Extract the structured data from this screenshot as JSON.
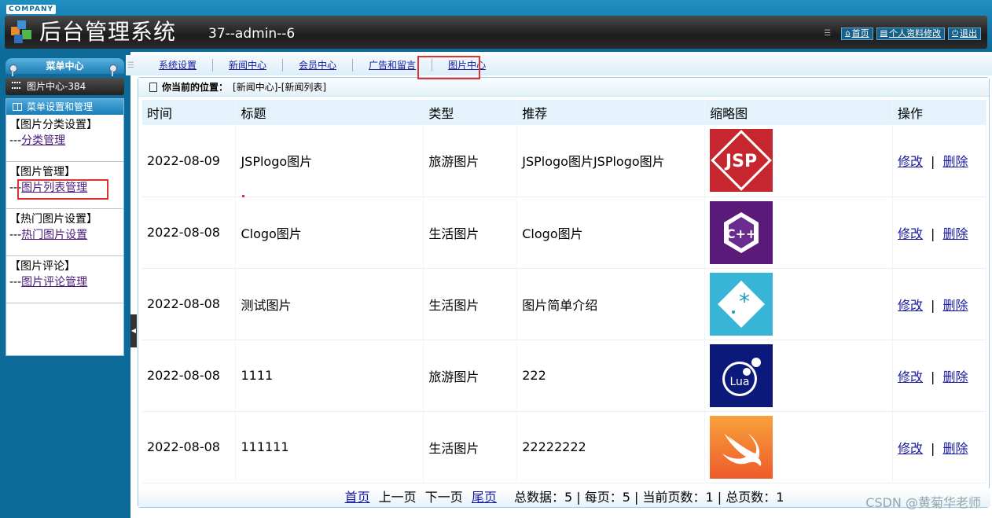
{
  "header": {
    "company": "COMPANY",
    "title": "后台管理系统",
    "user_info": "37--admin--6",
    "links": [
      {
        "label": "首页",
        "icon": "home-icon"
      },
      {
        "label": "个人资料修改",
        "icon": "document-icon"
      },
      {
        "label": "退出",
        "icon": "power-icon"
      }
    ]
  },
  "sidebar": {
    "title": "菜单中心",
    "current": "图片中心-384",
    "panel_title": "菜单设置和管理",
    "groups": [
      {
        "title": "【图片分类设置】",
        "prefix": "---",
        "link": "分类管理"
      },
      {
        "title": "【图片管理】",
        "prefix": "---",
        "link": "图片列表管理"
      },
      {
        "title": "【热门图片设置】",
        "prefix": "---",
        "link": "热门图片设置"
      },
      {
        "title": "【图片评论】",
        "prefix": "---",
        "link": "图片评论管理"
      }
    ]
  },
  "tabs": [
    "系统设置",
    "新闻中心",
    "会员中心",
    "广告和留言",
    "图片中心"
  ],
  "breadcrumb": {
    "label": "你当前的位置：",
    "path": "[新闻中心]-[新闻列表]"
  },
  "table": {
    "headers": [
      "时间",
      "标题",
      "类型",
      "推荐",
      "缩略图",
      "操作"
    ],
    "rows": [
      {
        "date": "2022-08-09",
        "title": "JSPlogo图片",
        "type": "旅游图片",
        "recommend": "JSPlogo图片JSPlogo图片",
        "thumb": "jsp-logo"
      },
      {
        "date": "2022-08-08",
        "title": "Clogo图片",
        "type": "生活图片",
        "recommend": "Clogo图片",
        "thumb": "cpp-logo"
      },
      {
        "date": "2022-08-08",
        "title": "测试图片",
        "type": "生活图片",
        "recommend": "图片简单介绍",
        "thumb": "star-logo"
      },
      {
        "date": "2022-08-08",
        "title": "1111",
        "type": "旅游图片",
        "recommend": "222",
        "thumb": "lua-logo"
      },
      {
        "date": "2022-08-08",
        "title": "111111",
        "type": "生活图片",
        "recommend": "22222222",
        "thumb": "swift-logo"
      }
    ],
    "edit_label": "修改",
    "separator": "|",
    "delete_label": "删除"
  },
  "pager": {
    "first": "首页",
    "prev": "上一页",
    "next": "下一页",
    "last": "尾页",
    "summary": "总数据：5 | 每页：5 | 当前页数：1 | 总页数：1"
  },
  "watermark": "CSDN @黄菊华老师",
  "colors": {
    "header_blue": "#0e6b99",
    "highlight_red": "#e0322e",
    "link": "#1a1aa0"
  }
}
